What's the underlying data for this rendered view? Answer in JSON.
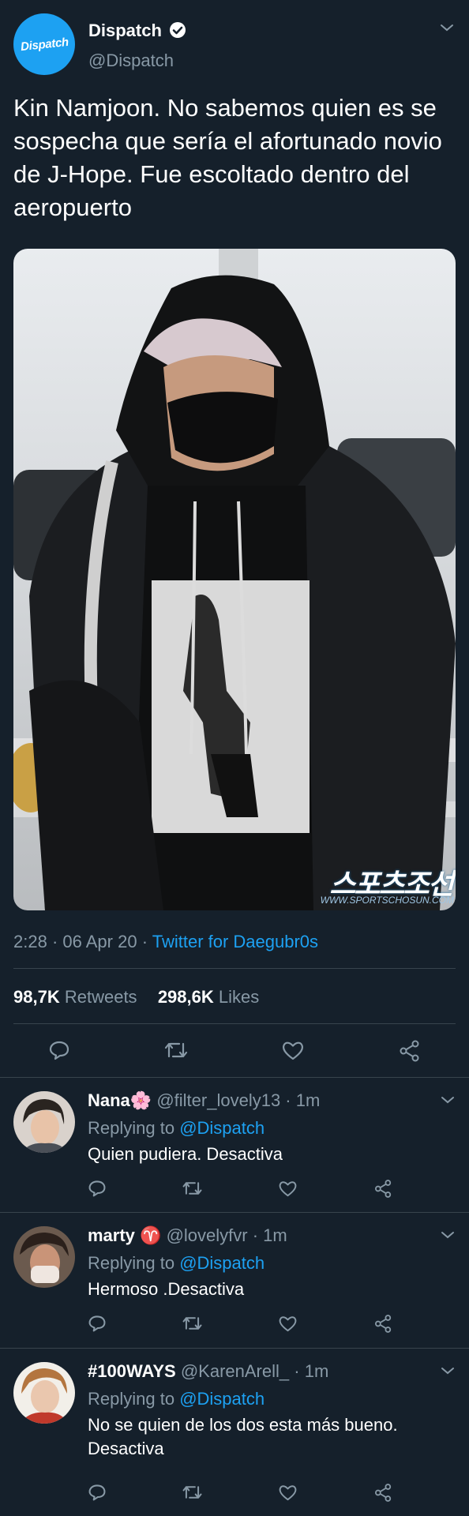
{
  "tweet": {
    "avatar_text": "Dispatch",
    "author_name": "Dispatch",
    "author_handle": "@Dispatch",
    "text": "Kin Namjoon. No sabemos quien es se sospecha que sería el afortunado novio de J-Hope. Fue escoltado dentro del aeropuerto",
    "photo_watermark": "스포츠조선",
    "photo_watermark_url": "WWW.SPORTSCHOSUN.COM",
    "time": "2:28",
    "date": "06 Apr 20",
    "client": "Twitter for Daegubr0s",
    "retweets_count": "98,7K",
    "retweets_label": "Retweets",
    "likes_count": "298,6K",
    "likes_label": "Likes"
  },
  "replies": [
    {
      "name": "Nana🌸",
      "handle": "@filter_lovely13",
      "time": "1m",
      "replying_label": "Replying to",
      "replying_to": "@Dispatch",
      "text": "Quien pudiera. Desactiva"
    },
    {
      "name": "marty ♈",
      "handle": "@lovelyfvr",
      "time": "1m",
      "replying_label": "Replying to",
      "replying_to": "@Dispatch",
      "text": "Hermoso .Desactiva"
    },
    {
      "name": "#100WAYS",
      "handle": "@KarenArell_",
      "time": "1m",
      "replying_label": "Replying to",
      "replying_to": "@Dispatch",
      "text": "No se quien de los dos esta más bueno. Desactiva"
    }
  ],
  "icons": [
    "verified-icon",
    "chevron-down-icon",
    "reply-icon",
    "retweet-icon",
    "like-icon",
    "share-icon"
  ],
  "colors": {
    "background": "#15202b",
    "text": "#ffffff",
    "muted": "#8899a6",
    "accent": "#1da1f2",
    "divider": "#38444d"
  }
}
